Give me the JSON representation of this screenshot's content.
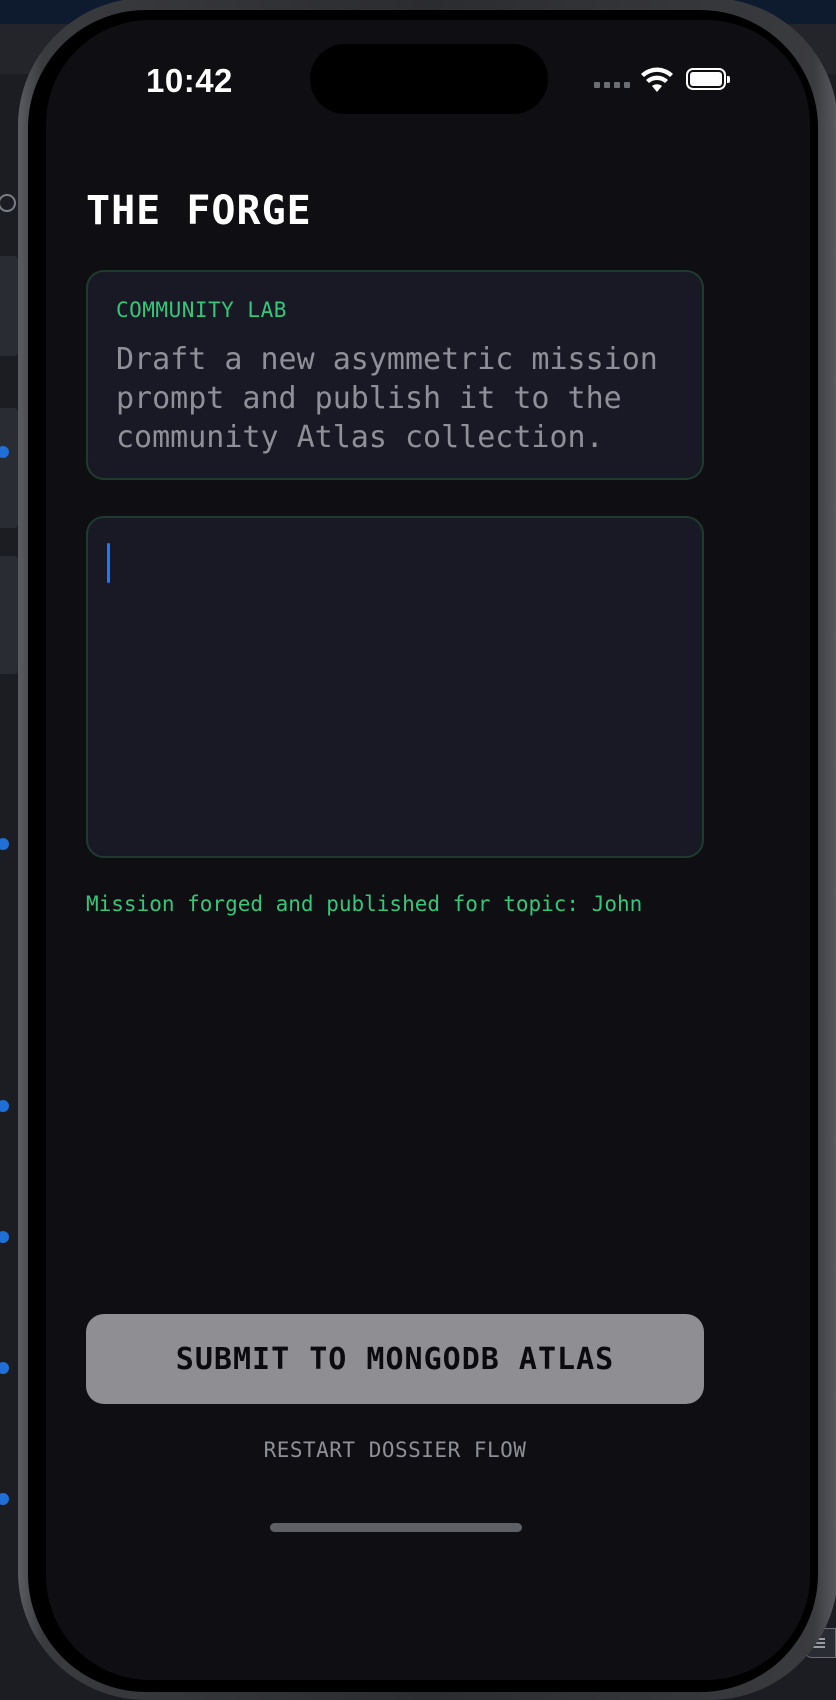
{
  "status_bar": {
    "time": "10:42",
    "signal_icon": "cellular-signal-icon",
    "wifi_icon": "wifi-icon",
    "battery_icon": "battery-icon"
  },
  "page": {
    "title": "THE FORGE"
  },
  "lab_card": {
    "label": "COMMUNITY LAB",
    "description": "Draft a new asymmetric mission prompt and publish it to the community Atlas collection."
  },
  "editor": {
    "value": "",
    "placeholder": ""
  },
  "status_message": "Mission forged and published for topic: John",
  "actions": {
    "submit_label": "SUBMIT TO MONGODB ATLAS",
    "restart_label": "RESTART DOSSIER FLOW"
  },
  "colors": {
    "background": "#0e0e13",
    "card": "#181924",
    "accent_green": "#34c77a",
    "muted_text": "#8f9097",
    "button": "#8e8e93",
    "caret": "#1a7bff"
  }
}
